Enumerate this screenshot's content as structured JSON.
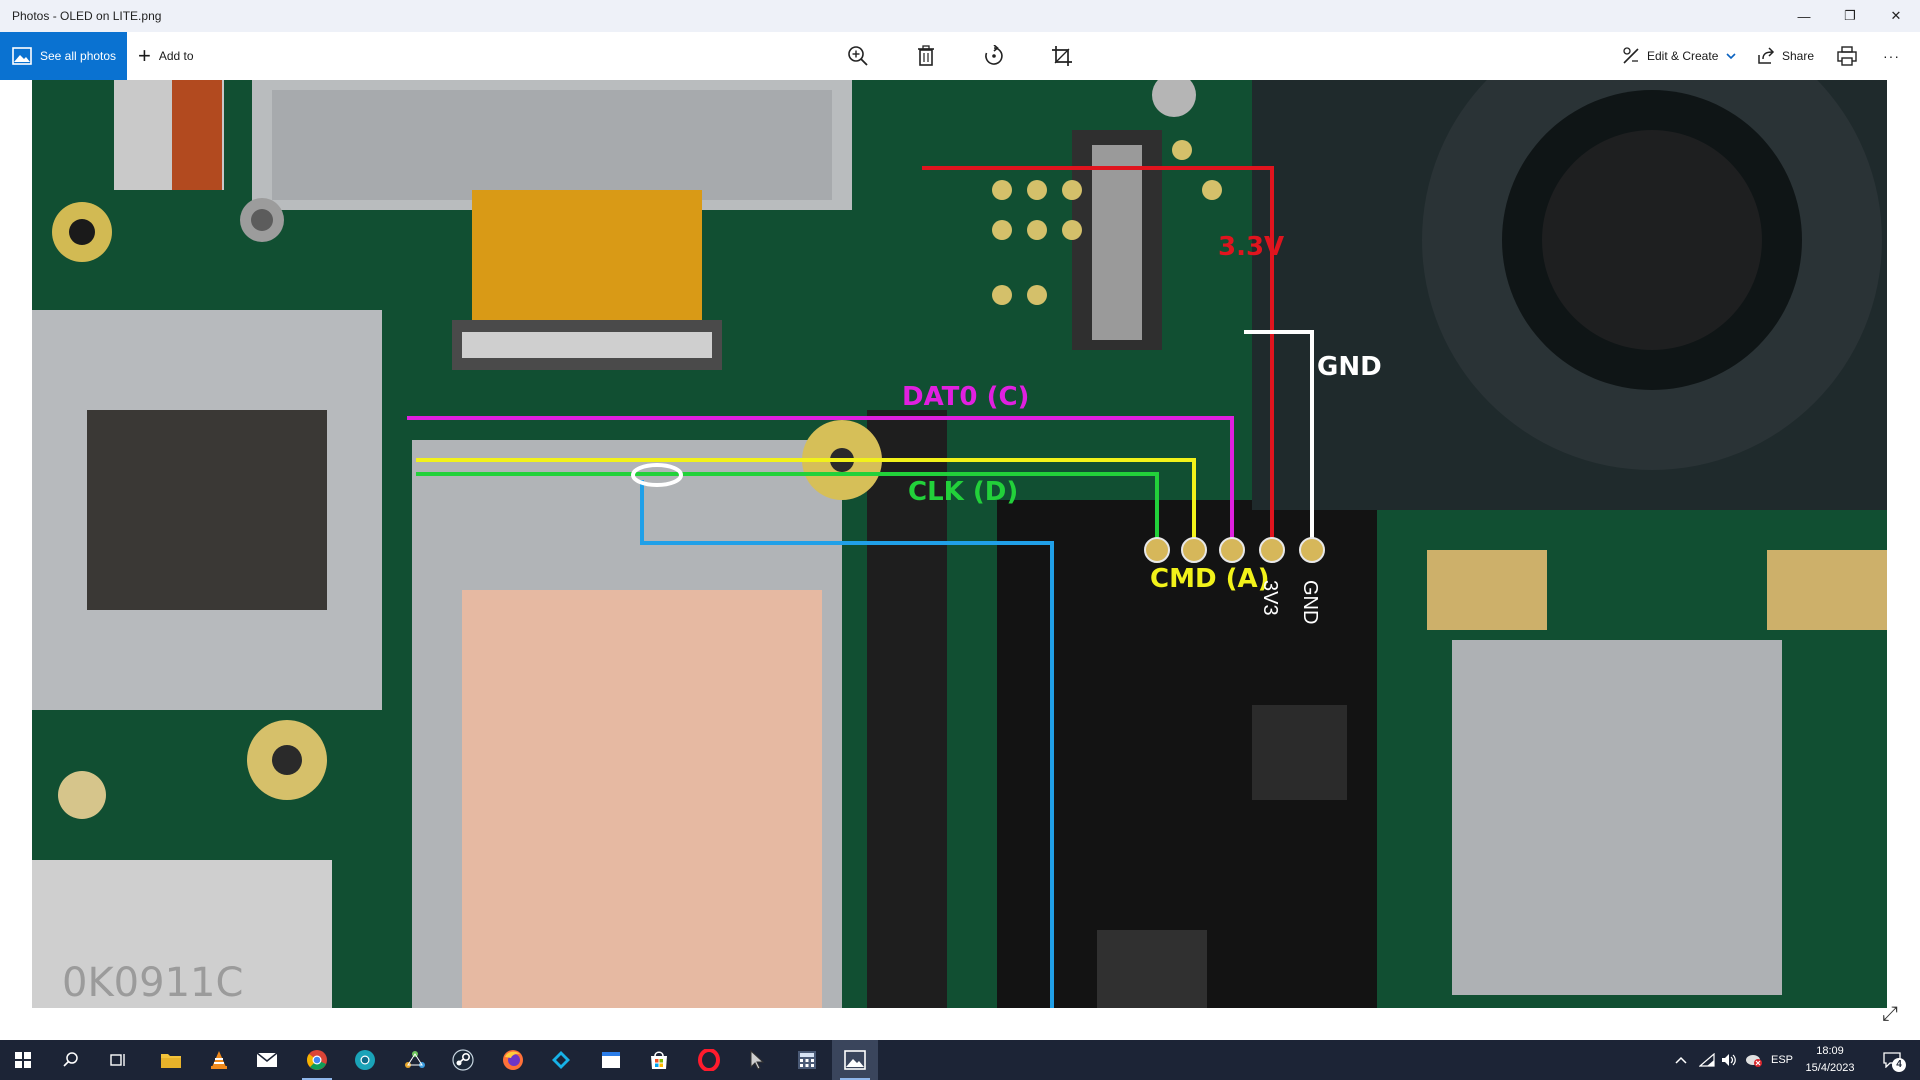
{
  "window": {
    "title": "Photos - OLED on LITE.png",
    "controls": {
      "minimize": "—",
      "restore": "❐",
      "close": "✕"
    }
  },
  "toolbar": {
    "see_all_label": "See all photos",
    "add_to_label": "Add to",
    "edit_create_label": "Edit & Create",
    "share_label": "Share",
    "more_label": "···",
    "center_icons": [
      "zoom-in-icon",
      "delete-icon",
      "rotate-icon",
      "crop-icon"
    ]
  },
  "image": {
    "labels": {
      "v33": "3.3V",
      "gnd": "GND",
      "dat0": "DAT0 (C)",
      "clk": "CLK (D)",
      "cmd": "CMD (A)",
      "pad_3v3": "3V3",
      "pad_gnd": "GND",
      "chip": "0K0911C"
    },
    "wire_colors": {
      "v33": "#e0141e",
      "gnd": "#ffffff",
      "dat0": "#e020e0",
      "cmd": "#f2f21a",
      "clk": "#22d13a",
      "extra": "#20a0e8"
    }
  },
  "taskbar": {
    "apps": [
      "start-icon",
      "search-icon",
      "task-view-icon",
      "file-explorer-icon",
      "vlc-icon",
      "mail-icon",
      "chrome-icon",
      "chrome-beta-icon",
      "network-app-icon",
      "steam-icon",
      "firefox-icon",
      "kodi-icon",
      "window-app-icon",
      "store-icon",
      "opera-icon",
      "cursor-app-icon",
      "calculator-icon",
      "photos-icon"
    ],
    "language": "ESP",
    "time": "18:09",
    "date": "15/4/2023",
    "notification_count": "4"
  }
}
